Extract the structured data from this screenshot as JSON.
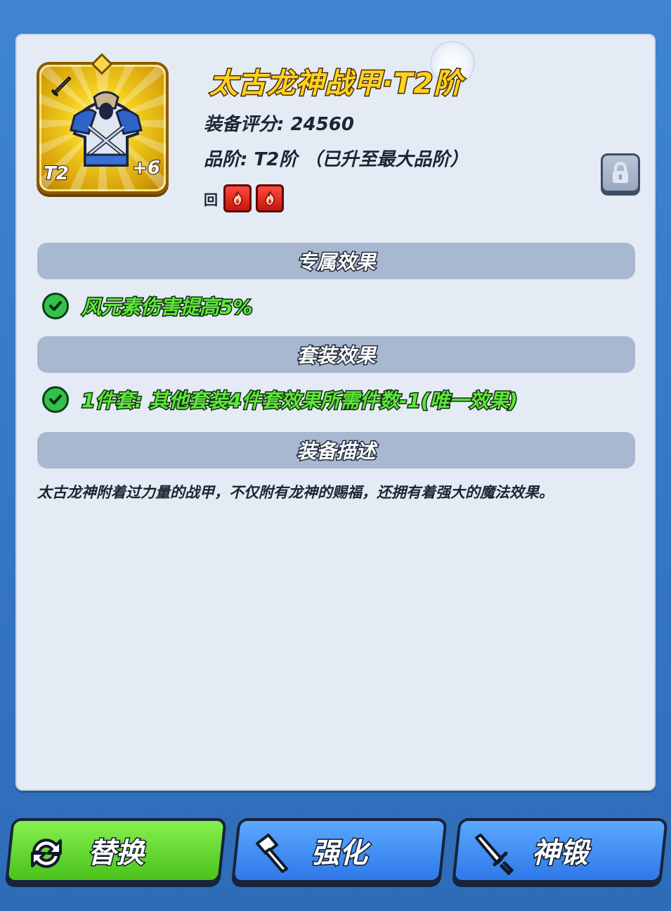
{
  "item": {
    "title": "太古龙神战甲·T2阶",
    "tier_badge": "T2",
    "enhance_level": "+6",
    "score_label": "装备评分: 24560",
    "grade_label": "品阶: T2阶 （已升至最大品阶）",
    "gem_prefix": "回",
    "gems": [
      "fire-gem-icon",
      "fire-gem-icon"
    ]
  },
  "sections": {
    "exclusive_title": "专属效果",
    "exclusive_effect": "风元素伤害提高5%",
    "set_title": "套装效果",
    "set_effect": "1件套: 其他套装4件套效果所需件数-1(唯一效果)",
    "desc_title": "装备描述",
    "description": "太古龙神附着过力量的战甲，不仅附有龙神的赐福，还拥有着强大的魔法效果。"
  },
  "buttons": {
    "replace": "替换",
    "enhance": "强化",
    "forge": "神锻"
  },
  "colors": {
    "panel_bg": "#e4ebf5",
    "section_bar": "#a9b8d1",
    "effect_green": "#5ee63a",
    "title_gold": "#ffd21e",
    "button_green": "#4bc21c",
    "button_blue": "#2f78e8"
  }
}
